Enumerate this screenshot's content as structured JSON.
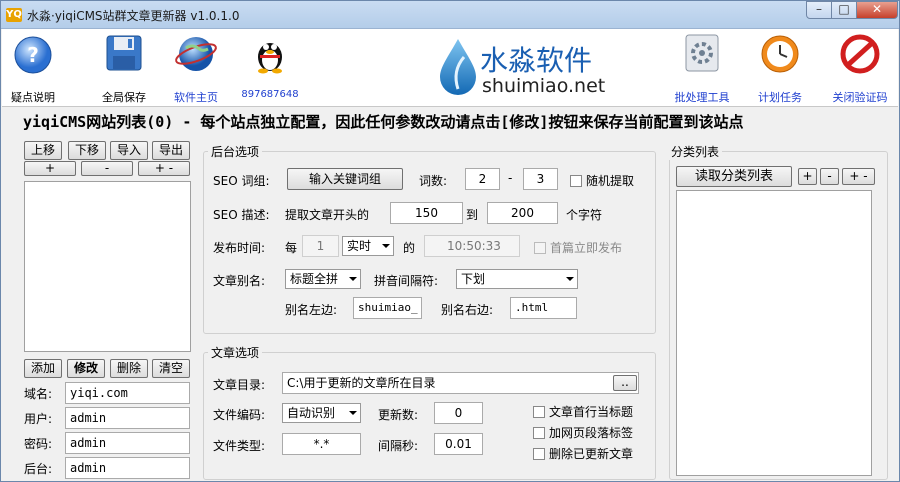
{
  "window": {
    "title": "水淼·yiqiCMS站群文章更新器 v1.0.1.0",
    "icon_text": "YQ",
    "minimize": "–",
    "maximize": "□",
    "close": "✕"
  },
  "toolbar": {
    "help": "疑点说明",
    "save": "全局保存",
    "home": "软件主页",
    "qq": "897687648",
    "batch": "批处理工具",
    "schedule": "计划任务",
    "close_verify": "关闭验证码"
  },
  "logo": {
    "cn": "水淼软件",
    "en": "shuimiao.net"
  },
  "headline": "yiqiCMS网站列表(0) - 每个站点独立配置，因此任何参数改动请点击[修改]按钮来保存当前配置到该站点",
  "sites": {
    "up": "上移",
    "down": "下移",
    "import": "导入",
    "export": "导出",
    "expand": "+",
    "collapse": "-",
    "toggle": "+ -",
    "add": "添加",
    "modify": "修改",
    "delete": "删除",
    "clear": "清空"
  },
  "site_form": {
    "domain_label": "域名:",
    "domain": "yiqi.com",
    "user_label": "用户:",
    "user": "admin",
    "pass_label": "密码:",
    "pass": "admin",
    "backend_label": "后台:",
    "backend": "admin"
  },
  "backend": {
    "title": "后台选项",
    "seo_kw_label": "SEO 词组:",
    "seo_kw_btn": "输入关键词组",
    "word_count_label": "词数:",
    "word_min": "2",
    "dash": "-",
    "word_max": "3",
    "random_pick": "随机提取",
    "seo_desc_label": "SEO 描述:",
    "desc_prefix": "提取文章开头的",
    "desc_min": "150",
    "desc_to": "到",
    "desc_max": "200",
    "desc_suffix": "个字符",
    "publish_label": "发布时间:",
    "every": "每",
    "publish_n": "1",
    "publish_unit": "实时",
    "of": "的",
    "publish_time": "10:50:33",
    "first_publish": "首篇立即发布",
    "alias_label": "文章别名:",
    "alias_mode": "标题全拼",
    "pinyin_sep_label": "拼音间隔符:",
    "pinyin_sep": "下划",
    "alias_left_label": "别名左边:",
    "alias_left": "shuimiao_",
    "alias_right_label": "别名右边:",
    "alias_right": ".html"
  },
  "article": {
    "title": "文章选项",
    "dir_label": "文章目录:",
    "dir": "C:\\用于更新的文章所在目录",
    "browse": "..",
    "enc_label": "文件编码:",
    "encoding": "自动识别",
    "update_count_label": "更新数:",
    "update_count": "0",
    "type_label": "文件类型:",
    "file_type": "*.*",
    "interval_label": "间隔秒:",
    "interval": "0.01",
    "first_line_title": "文章首行当标题",
    "add_p_tags": "加网页段落标签",
    "delete_updated": "删除已更新文章"
  },
  "category": {
    "title": "分类列表",
    "read_btn": "读取分类列表",
    "plus": "+",
    "minus": "-",
    "toggle": "+ -"
  },
  "colors": {
    "accent_blue": "#1f3fcf",
    "title_bar": "#c9dcf2"
  }
}
